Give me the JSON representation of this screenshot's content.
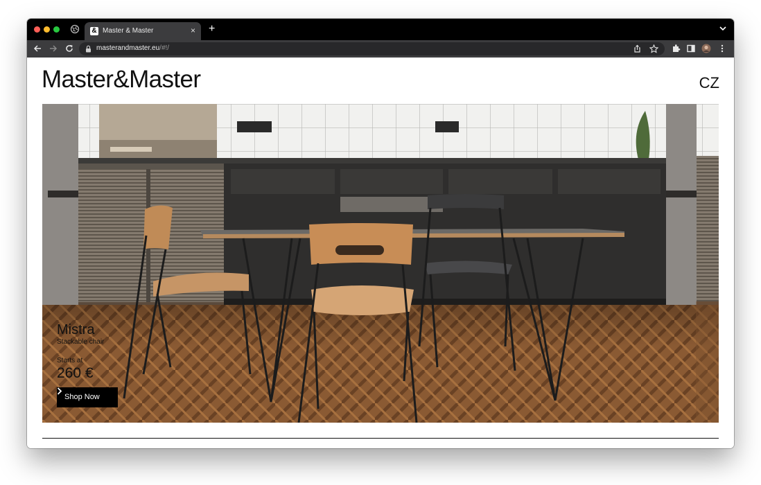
{
  "browser": {
    "tab_title": "Master & Master",
    "new_tab_symbol": "+",
    "close_symbol": "×",
    "favicon_letter": "&",
    "url_host": "masterandmaster.eu",
    "url_path": "/#!/"
  },
  "header": {
    "logo": "Master&Master",
    "language": "CZ"
  },
  "hero": {
    "product_name": "Mistra",
    "product_subtitle": "Stackable chair",
    "price_prefix": "Starts at",
    "price": "260 €",
    "cta_label": "Shop Now"
  },
  "colors": {
    "tab_strip": "#000000",
    "toolbar": "#3c3c3e",
    "cta_background": "#000000",
    "cta_text": "#ffffff"
  },
  "icons": [
    "globe-icon",
    "favicon-icon",
    "close-icon",
    "plus-icon",
    "chevron-down-icon",
    "back-arrow-icon",
    "forward-arrow-icon",
    "reload-icon",
    "lock-icon",
    "share-icon",
    "star-icon",
    "extensions-icon",
    "side-panel-icon",
    "profile-icon",
    "kebab-menu-icon",
    "chevron-right-icon"
  ]
}
